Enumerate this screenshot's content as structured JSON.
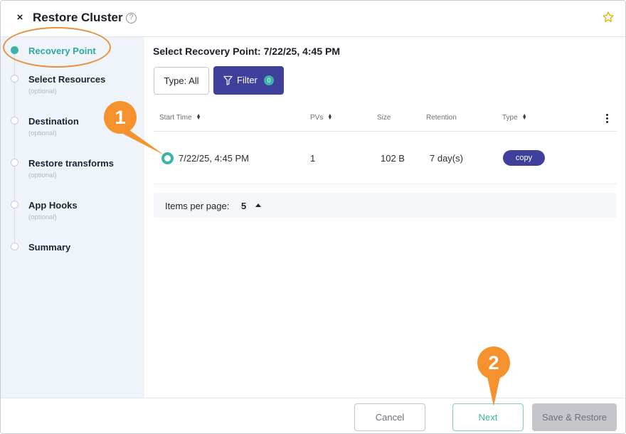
{
  "header": {
    "title": "Restore Cluster",
    "help_glyph": "?",
    "close_glyph": "×"
  },
  "sidebar": {
    "steps": [
      {
        "label": "Recovery Point",
        "sub": "",
        "active": true
      },
      {
        "label": "Select Resources",
        "sub": "(optional)",
        "active": false
      },
      {
        "label": "Destination",
        "sub": "(optional)",
        "active": false
      },
      {
        "label": "Restore transforms",
        "sub": "(optional)",
        "active": false
      },
      {
        "label": "App Hooks",
        "sub": "(optional)",
        "active": false
      },
      {
        "label": "Summary",
        "sub": "",
        "active": false
      }
    ]
  },
  "main": {
    "section_title": "Select Recovery Point: 7/22/25, 4:45 PM",
    "type_button": "Type: All",
    "filter_button": "Filter",
    "filter_count": "0",
    "table": {
      "headers": [
        "Start Time",
        "PVs",
        "Size",
        "Retention",
        "Type"
      ],
      "rows": [
        {
          "start_time": "7/22/25, 4:45 PM",
          "pvs": "1",
          "size": "102 B",
          "retention": "7 day(s)",
          "type": "copy"
        }
      ]
    },
    "pager": {
      "label": "Items per page:",
      "value": "5"
    }
  },
  "footer": {
    "cancel": "Cancel",
    "next": "Next",
    "save_restore": "Save & Restore"
  },
  "callouts": [
    "1",
    "2"
  ],
  "colors": {
    "accent_teal": "#3bb3a8",
    "primary_indigo": "#3f3f9c",
    "callout_orange": "#f5922e",
    "sidebar_bg": "#eff3fa"
  },
  "icons": {
    "close": "close-icon",
    "help": "help-circle-icon",
    "favorite": "star-outline-icon",
    "filter": "funnel-icon",
    "sort": "sort-icon",
    "more": "kebab-menu-icon",
    "pager_toggle": "caret-up-icon"
  }
}
